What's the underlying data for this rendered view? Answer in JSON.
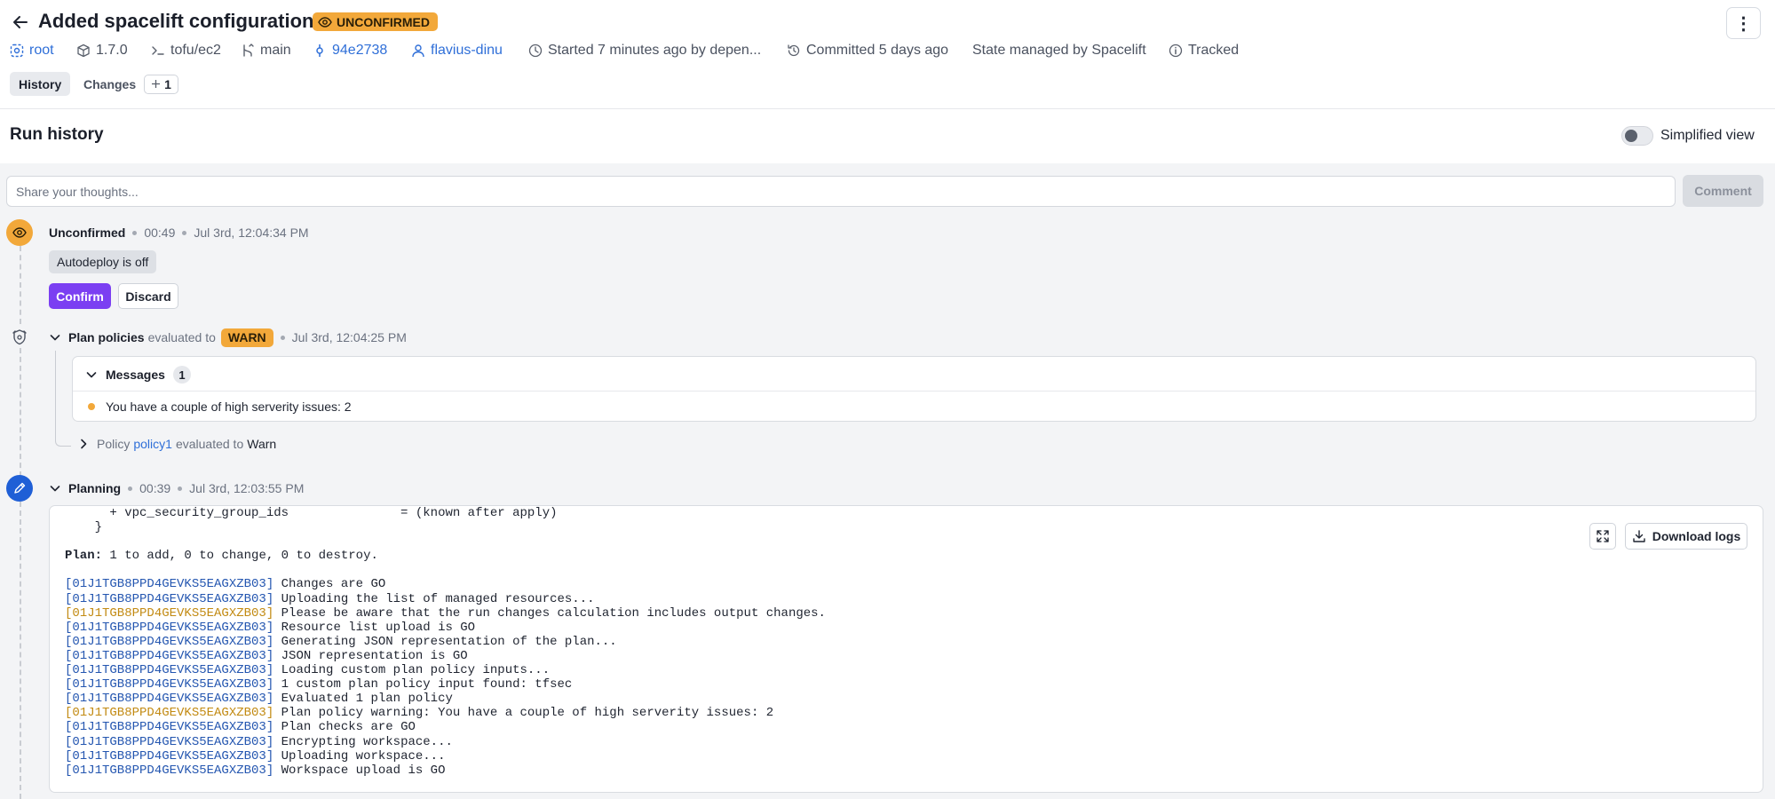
{
  "header": {
    "title": "Added spacelift configuration",
    "status_badge": "UNCONFIRMED",
    "more_label": "⋮"
  },
  "meta": {
    "space": "root",
    "version": "1.7.0",
    "project_root": "tofu/ec2",
    "branch": "main",
    "commit": "94e2738",
    "author": "flavius-dinu",
    "started": "Started 7 minutes ago by depen...",
    "committed": "Committed 5 days ago",
    "state": "State managed by Spacelift",
    "tracked": "Tracked"
  },
  "tabs": {
    "history": "History",
    "changes": "Changes",
    "changes_count": "1"
  },
  "section": {
    "title": "Run history",
    "toggle_label": "Simplified view"
  },
  "comment": {
    "placeholder": "Share your thoughts...",
    "button": "Comment"
  },
  "unconfirmed": {
    "label": "Unconfirmed",
    "duration": "00:49",
    "time": "Jul 3rd, 12:04:34 PM",
    "autodeploy": "Autodeploy is off",
    "confirm": "Confirm",
    "discard": "Discard"
  },
  "policies": {
    "label": "Plan policies",
    "evaluated_to": "evaluated to",
    "result": "WARN",
    "time": "Jul 3rd, 12:04:25 PM",
    "messages_title": "Messages",
    "messages_count": "1",
    "message": "You have a couple of high serverity issues: 2",
    "policy_prefix": "Policy",
    "policy_name": "policy1",
    "policy_suffix": "evaluated to",
    "policy_result": "Warn"
  },
  "planning": {
    "label": "Planning",
    "duration": "00:39",
    "time": "Jul 3rd, 12:03:55 PM",
    "download": "Download logs",
    "log_pre": [
      "      + vpc_security_group_ids               = (known after apply)",
      "    }"
    ],
    "plan_bold": "Plan:",
    "plan_rest": " 1 to add, 0 to change, 0 to destroy.",
    "log_entries": [
      {
        "id": "[01J1TGB8PPD4GEVKS5EAGXZB03]",
        "text": " Changes are GO",
        "warn": false
      },
      {
        "id": "[01J1TGB8PPD4GEVKS5EAGXZB03]",
        "text": " Uploading the list of managed resources...",
        "warn": false
      },
      {
        "id": "[01J1TGB8PPD4GEVKS5EAGXZB03]",
        "text": " Please be aware that the run changes calculation includes output changes.",
        "warn": true
      },
      {
        "id": "[01J1TGB8PPD4GEVKS5EAGXZB03]",
        "text": " Resource list upload is GO",
        "warn": false
      },
      {
        "id": "[01J1TGB8PPD4GEVKS5EAGXZB03]",
        "text": " Generating JSON representation of the plan...",
        "warn": false
      },
      {
        "id": "[01J1TGB8PPD4GEVKS5EAGXZB03]",
        "text": " JSON representation is GO",
        "warn": false
      },
      {
        "id": "[01J1TGB8PPD4GEVKS5EAGXZB03]",
        "text": " Loading custom plan policy inputs...",
        "warn": false
      },
      {
        "id": "[01J1TGB8PPD4GEVKS5EAGXZB03]",
        "text": " 1 custom plan policy input found: tfsec",
        "warn": false
      },
      {
        "id": "[01J1TGB8PPD4GEVKS5EAGXZB03]",
        "text": " Evaluated 1 plan policy",
        "warn": false
      },
      {
        "id": "[01J1TGB8PPD4GEVKS5EAGXZB03]",
        "text": " Plan policy warning: You have a couple of high serverity issues: 2",
        "warn": true
      },
      {
        "id": "[01J1TGB8PPD4GEVKS5EAGXZB03]",
        "text": " Plan checks are GO",
        "warn": false
      },
      {
        "id": "[01J1TGB8PPD4GEVKS5EAGXZB03]",
        "text": " Encrypting workspace...",
        "warn": false
      },
      {
        "id": "[01J1TGB8PPD4GEVKS5EAGXZB03]",
        "text": " Uploading workspace...",
        "warn": false
      },
      {
        "id": "[01J1TGB8PPD4GEVKS5EAGXZB03]",
        "text": " Workspace upload is GO",
        "warn": false
      }
    ]
  },
  "colors": {
    "accent_purple": "#7b3ff2",
    "warn_orange": "#f2a83a",
    "link_blue": "#2f6fd8",
    "planning_blue": "#1f5fd6"
  },
  "icons": [
    "back-arrow-icon",
    "eye-icon",
    "more-icon",
    "space-icon",
    "cube-icon",
    "terminal-icon",
    "branch-icon",
    "commit-icon",
    "user-icon",
    "clock-icon",
    "history-icon",
    "info-icon",
    "plus-icon",
    "chevron-down-icon",
    "chevron-right-icon",
    "shield-icon",
    "pencil-icon",
    "expand-icon",
    "download-icon"
  ]
}
